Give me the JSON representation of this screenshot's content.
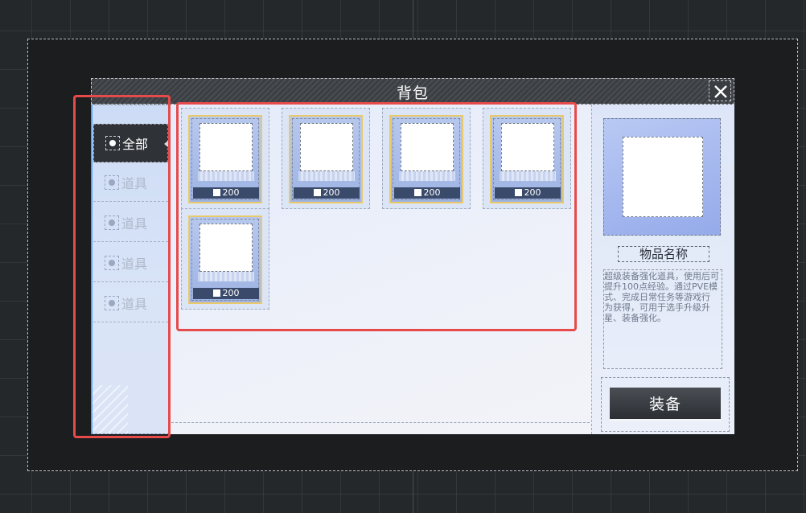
{
  "title": "背包",
  "close_icon": "close-icon",
  "tabs": [
    {
      "label": "全部",
      "active": true
    },
    {
      "label": "道具",
      "active": false
    },
    {
      "label": "道具",
      "active": false
    },
    {
      "label": "道具",
      "active": false
    },
    {
      "label": "道具",
      "active": false
    }
  ],
  "items": [
    {
      "count": "200"
    },
    {
      "count": "200"
    },
    {
      "count": "200"
    },
    {
      "count": "200"
    },
    {
      "count": "200"
    }
  ],
  "detail": {
    "name": "物品名称",
    "description": "超级装备强化道具，使用后可提升100点经验。通过PVE模式、完成日常任务等游戏行\n为获得，可用于选手升级升星、装备强化。",
    "equip_label": "装备"
  },
  "colors": {
    "highlight": "#e64a4a",
    "frame_gold": "#e9c96a",
    "count_bg": "#3a4a6a"
  }
}
